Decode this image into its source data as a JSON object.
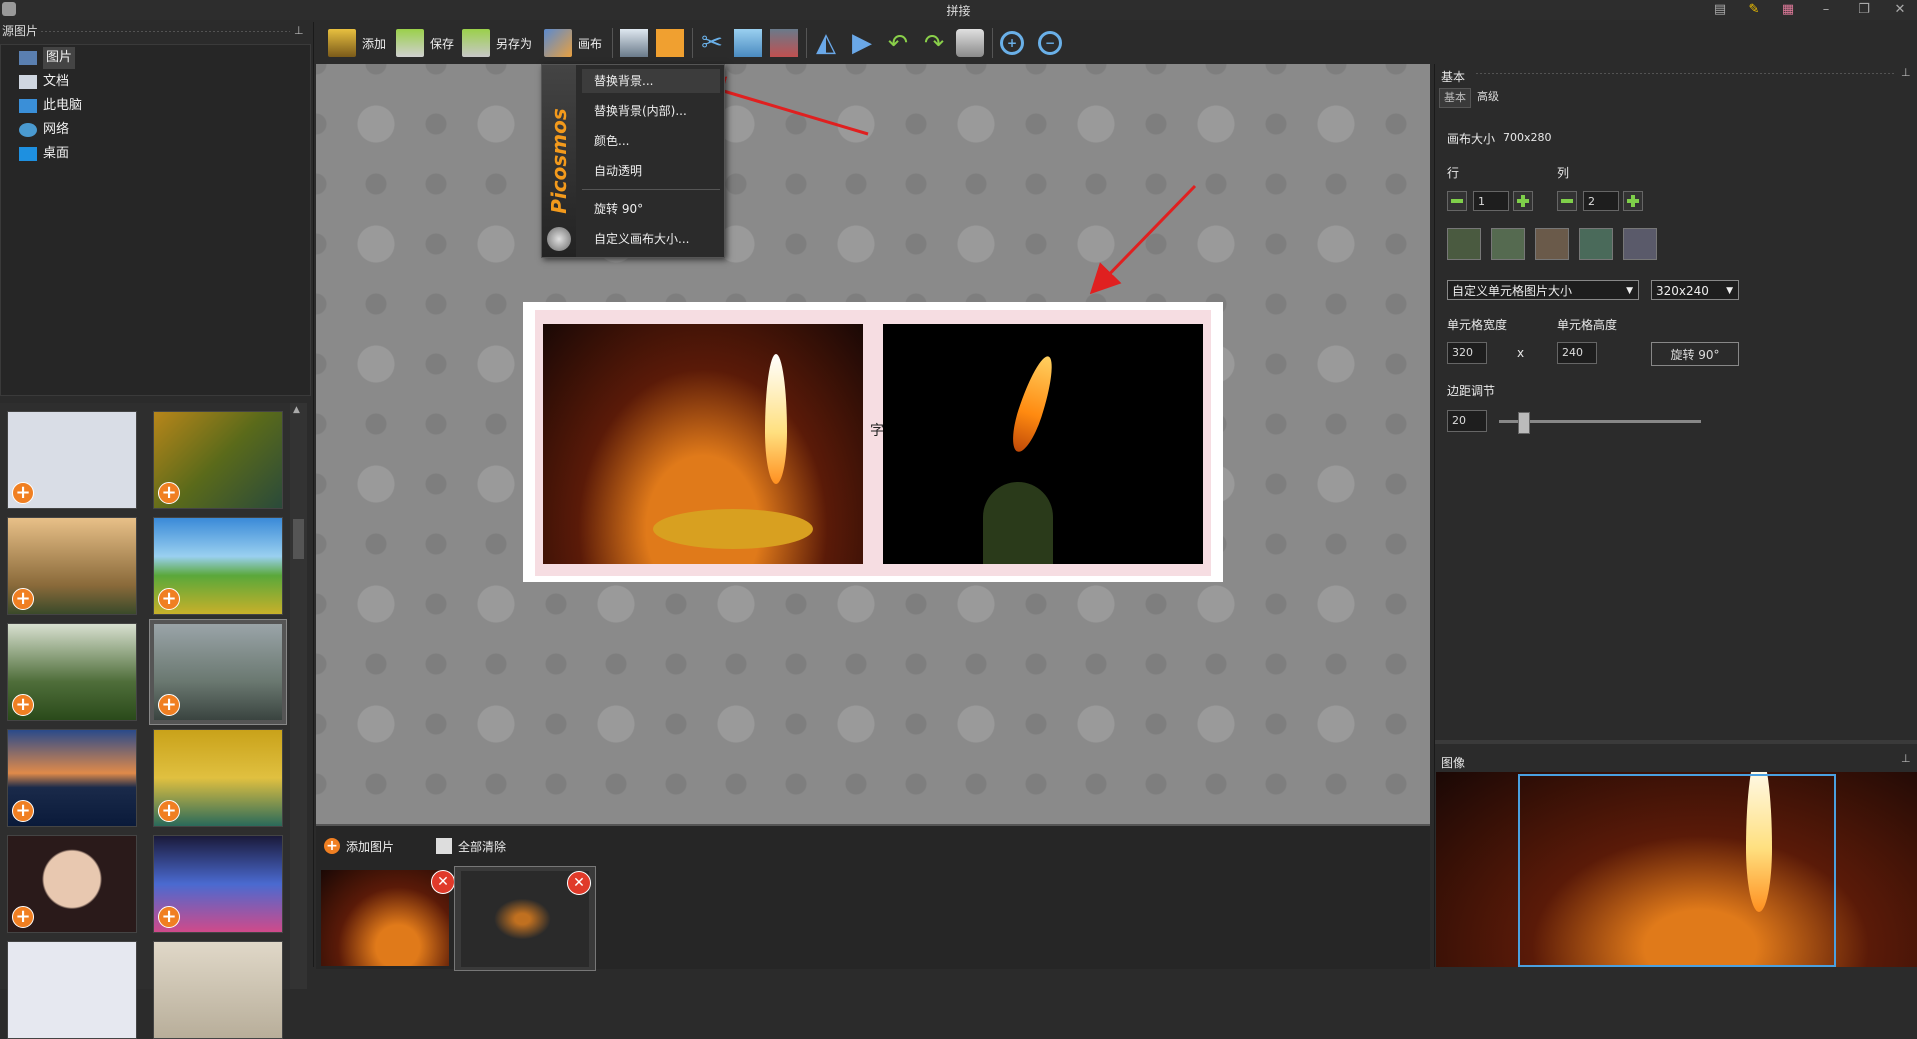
{
  "window": {
    "title": "拼接",
    "controls": [
      "minimize",
      "restore",
      "close"
    ]
  },
  "left_panel": {
    "header": "源图片",
    "tree": [
      {
        "label": "图片",
        "icon": "pictures-icon",
        "selected": true
      },
      {
        "label": "文档",
        "icon": "documents-icon",
        "selected": false
      },
      {
        "label": "此电脑",
        "icon": "computer-icon",
        "selected": false
      },
      {
        "label": "网络",
        "icon": "network-icon",
        "selected": false
      },
      {
        "label": "桌面",
        "icon": "desktop-icon",
        "selected": false
      }
    ],
    "thumbnails": [
      {
        "desc": "screenshot",
        "color": "#d9dde6"
      },
      {
        "desc": "autumn road",
        "color": "#8a7a2a"
      },
      {
        "desc": "misty castle",
        "color": "#c8a26a"
      },
      {
        "desc": "green tree field",
        "color": "#3f8a3a"
      },
      {
        "desc": "forest hills",
        "color": "#4f6e3a"
      },
      {
        "desc": "river boat",
        "color": "#7a8680"
      },
      {
        "desc": "bridge dusk",
        "color": "#2e4a7a"
      },
      {
        "desc": "yellow boats",
        "color": "#c9a21a"
      },
      {
        "desc": "portrait",
        "color": "#6a4a4a"
      },
      {
        "desc": "app grid",
        "color": "#3a3c5a"
      },
      {
        "desc": "screenshot 2",
        "color": "#e6e8f0"
      },
      {
        "desc": "desert",
        "color": "#c8bfae"
      }
    ]
  },
  "toolbar": {
    "add": "添加",
    "save": "保存",
    "save_as": "另存为",
    "canvas": "画布"
  },
  "canvas_menu": {
    "brand": "Picosmos",
    "items": [
      "替换背景...",
      "替换背景(内部)...",
      "颜色...",
      "自动透明",
      "旋转 90°",
      "自定义画布大小..."
    ]
  },
  "canvas": {
    "cell_overlay_text": "字"
  },
  "tray": {
    "add_image": "添加图片",
    "clear_all": "全部清除"
  },
  "right_panel": {
    "header": "基本",
    "tabs": [
      "基本",
      "高级"
    ],
    "canvas_size_label": "画布大小",
    "canvas_size_value": "700x280",
    "rows_label": "行",
    "rows_value": "1",
    "cols_label": "列",
    "cols_value": "2",
    "cell_mode_select": "自定义单元格图片大小",
    "cell_size_select": "320x240",
    "cell_width_label": "单元格宽度",
    "cell_width_value": "320",
    "x_sep": "x",
    "cell_height_label": "单元格高度",
    "cell_height_value": "240",
    "rotate_button": "旋转 90°",
    "margin_label": "边距调节",
    "margin_value": "20",
    "margin_slider_fraction": 0.12,
    "image_header": "图像"
  },
  "colors": {
    "accent_orange": "#f07f22",
    "plus_green": "#7fd04a",
    "close_red": "#e03a2a",
    "arrow_red": "#e02020",
    "collage_inner": "#f6dde2"
  }
}
